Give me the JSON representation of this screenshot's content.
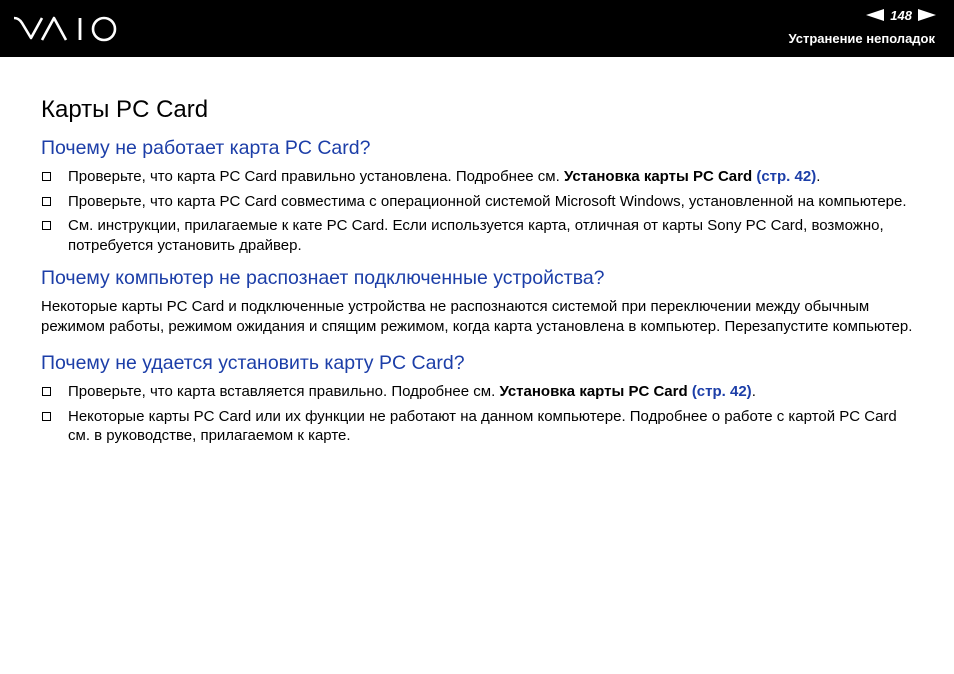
{
  "header": {
    "logo_text": "VAIO",
    "page_number": "148",
    "section_title": "Устранение неполадок",
    "bg_color": "#000000"
  },
  "page_title": "Карты PC Card",
  "accent_color": "#1c3ea8",
  "q1": {
    "heading": "Почему не работает карта PC Card?",
    "item1": {
      "text": "Проверьте, что карта PC Card правильно установлена. Подробнее см.",
      "bold": "Установка карты PC Card",
      "link": "(стр. 42)",
      "tail": "."
    },
    "item2": "Проверьте, что карта PC Card совместима с операционной системой Microsoft Windows, установленной на компьютере.",
    "item3": "См. инструкции, прилагаемые к кате PC Card. Если используется карта, отличная от карты Sony PC Card, возможно, потребуется установить драйвер."
  },
  "q2": {
    "heading": "Почему компьютер не распознает подключенные устройства?",
    "paragraph": "Некоторые карты PC Card и подключенные устройства не распознаются системой при переключении между обычным режимом работы, режимом ожидания и спящим режимом, когда карта установлена в компьютер. Перезапустите компьютер."
  },
  "q3": {
    "heading": "Почему не удается установить карту PC Card?",
    "item1": {
      "text": "Проверьте, что карта вставляется правильно. Подробнее см.",
      "bold": "Установка карты PC Card",
      "link": "(стр. 42)",
      "tail": "."
    },
    "item2": "Некоторые карты PC Card или их функции не работают на данном компьютере. Подробнее о работе с картой PC Card см. в руководстве, прилагаемом к карте."
  }
}
